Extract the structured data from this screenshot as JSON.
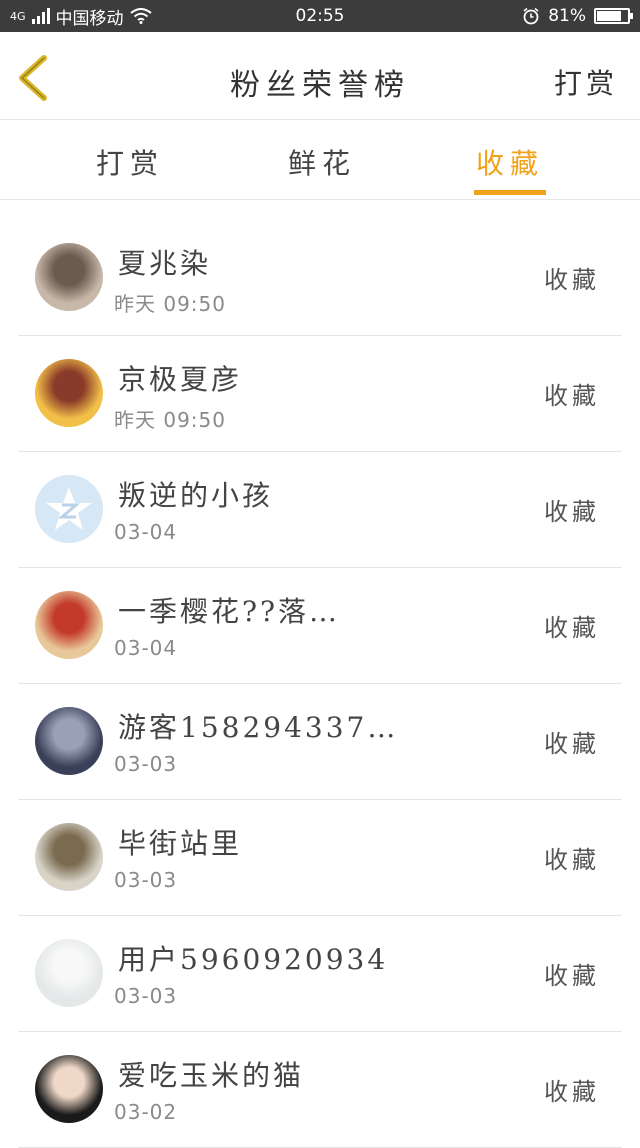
{
  "status_bar": {
    "carrier": "中国移动",
    "network": "4G",
    "time": "02:55",
    "battery": "81%",
    "battery_level": 0.81
  },
  "header": {
    "title": "粉丝荣誉榜",
    "action_label": "打赏",
    "accent_color": "#f0a21a"
  },
  "tabs": [
    {
      "label": "打赏",
      "active": false
    },
    {
      "label": "鲜花",
      "active": false
    },
    {
      "label": "收藏",
      "active": true
    }
  ],
  "list": [
    {
      "name": "夏兆染",
      "time": "昨天 09:50",
      "action": "收藏",
      "avatar_colors": [
        "#c8b8a8",
        "#6a5a50"
      ]
    },
    {
      "name": "京极夏彦",
      "time": "昨天 09:50",
      "action": "收藏",
      "avatar_colors": [
        "#f2c048",
        "#8a3a2a"
      ]
    },
    {
      "name": "叛逆的小孩",
      "time": "03-04",
      "action": "收藏",
      "avatar_colors": [
        "#d4e6f6",
        "#ffffff"
      ]
    },
    {
      "name": "一季樱花??落…",
      "time": "03-04",
      "action": "收藏",
      "avatar_colors": [
        "#e8c89a",
        "#c43a2a"
      ]
    },
    {
      "name": "游客158294337…",
      "time": "03-03",
      "action": "收藏",
      "avatar_colors": [
        "#3a4058",
        "#9aa0b8"
      ]
    },
    {
      "name": "毕街站里",
      "time": "03-03",
      "action": "收藏",
      "avatar_colors": [
        "#d8d4c8",
        "#7a6a50"
      ]
    },
    {
      "name": "用户5960920934",
      "time": "03-03",
      "action": "收藏",
      "avatar_colors": [
        "#e4e8e8",
        "#f8f8f8"
      ]
    },
    {
      "name": "爱吃玉米的猫",
      "time": "03-02",
      "action": "收藏",
      "avatar_colors": [
        "#1a1a1a",
        "#f0d8c8"
      ]
    }
  ]
}
